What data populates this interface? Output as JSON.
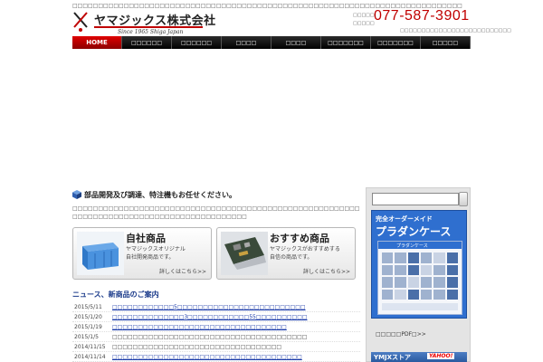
{
  "header": {
    "tagline": "□□□□□□□□□□□□□□□□□□□□□□□□□□□□□□□□□□□□□□□□□□□□□□□□□□□□□□□□□□□□□□□□□□□□□□□□□□□□",
    "company_name": "ヤマジックス株式会社",
    "since": "Since 1965 Shiga Japan",
    "phone_caption": "□□□□□ □□□□□",
    "phone_number": "077-587-3901",
    "sub_text": "□□□□□□□□□□□□□□□□□□□□□□□□□□"
  },
  "nav": {
    "items": [
      {
        "label": "HOME"
      },
      {
        "label": "□□□□□□"
      },
      {
        "label": "□□□□□□"
      },
      {
        "label": "□□□□"
      },
      {
        "label": "□□□□"
      },
      {
        "label": "□□□□□□□"
      },
      {
        "label": "□□□□□□□"
      },
      {
        "label": "□□□□□"
      }
    ]
  },
  "intro": {
    "title": "部品開発及び調達、特注機もお任せください。",
    "text": "□□□□□□□□□□□□□□□□□□□□□□□□□□□□□□□□□□□□□□□□□□□□□□□□□□□□□□□□□□□□□□□□□□□□□□□□□□□□□□□□□□□□□□□□□□"
  },
  "cards": [
    {
      "title": "自社商品",
      "desc_1": "ヤマジックスオリジナル",
      "desc_2": "自社開発商品です。",
      "link": "詳しくはこちら>>"
    },
    {
      "title": "おすすめ商品",
      "desc_1": "ヤマジックスがおすすめする",
      "desc_2": "自信の商品です。",
      "link": "詳しくはこちら>>"
    }
  ],
  "news": {
    "heading": "ニュース、新商品のご案内",
    "items": [
      {
        "date": "2015/5/11",
        "title": "□□□□□□□□□□□□5□□□□□□□□□□□□□□□□□□□□□□□□□"
      },
      {
        "date": "2015/1/20",
        "title": "□□□□□□□□□□□□□□3□□□□□□□□□□□□55□□□□□□□□□□"
      },
      {
        "date": "2015/1/19",
        "title": "□□□□□□□□□□□□□□□□□□□□□□□□□□□□□□□□□□"
      },
      {
        "date": "2015/1/5",
        "title": "□□□□□□□□□□□□□□□□□□□□□□□□□□□□□□□□□□□□□□"
      },
      {
        "date": "2014/11/15",
        "title": "□□□□□□□□□□□□□□□□□□□□□□□□□□□□□□□□□"
      },
      {
        "date": "2014/11/14",
        "title": "□□□□□□□□□□□□□□□□□□□□□□□□□□□□□□□□□□□□□"
      }
    ]
  },
  "sidebar": {
    "banner_top": "完全オーダーメイド",
    "banner_main": "プラダンケース",
    "catalog_title": "プラダンケース",
    "pdf_link": "□□□□□PDF□>>",
    "store_text": "YMJXストア",
    "store_badge": "YAHOO!"
  },
  "colors": {
    "brand_red": "#c00000",
    "nav_dark": "#000000",
    "banner_blue": "#2f6fcf",
    "link_blue": "#1a3aa8"
  }
}
